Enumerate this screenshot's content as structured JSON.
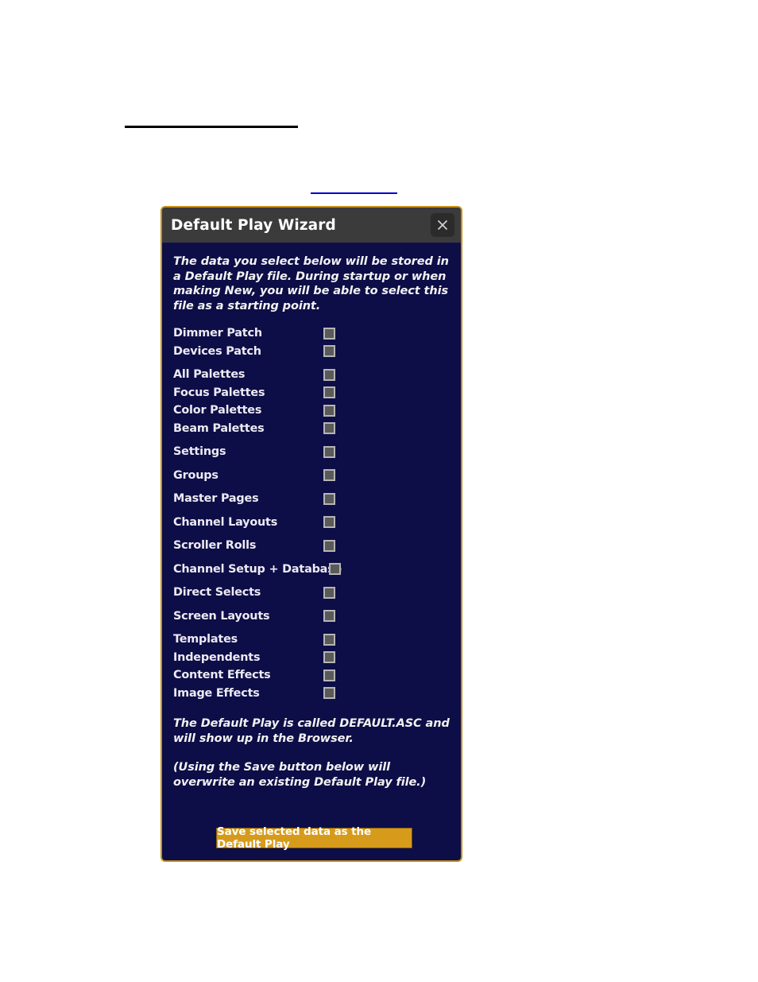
{
  "page": {
    "horizontal_rule": "",
    "link_text": ""
  },
  "dialog": {
    "title": "Default Play Wizard",
    "close_icon": "close-icon",
    "intro_text": "The data you select below will be stored in a Default Play file. During startup or when making New, you will be able to select this file as a starting point.",
    "options": [
      {
        "label": "Dimmer Patch",
        "checked": false
      },
      {
        "label": "Devices Patch",
        "checked": false
      },
      {
        "label": "All Palettes",
        "checked": false
      },
      {
        "label": "Focus Palettes",
        "checked": false
      },
      {
        "label": "Color Palettes",
        "checked": false
      },
      {
        "label": "Beam Palettes",
        "checked": false
      },
      {
        "label": "Settings",
        "checked": false
      },
      {
        "label": "Groups",
        "checked": false
      },
      {
        "label": "Master Pages",
        "checked": false
      },
      {
        "label": "Channel Layouts",
        "checked": false
      },
      {
        "label": "Scroller Rolls",
        "checked": false
      },
      {
        "label": "Channel Setup + Database",
        "checked": false
      },
      {
        "label": "Direct Selects",
        "checked": false
      },
      {
        "label": "Screen Layouts",
        "checked": false
      },
      {
        "label": "Templates",
        "checked": false
      },
      {
        "label": "Independents",
        "checked": false
      },
      {
        "label": "Content Effects",
        "checked": false
      },
      {
        "label": "Image Effects",
        "checked": false
      }
    ],
    "footer_text_1": "The Default Play is called DEFAULT.ASC and will show up in the Browser.",
    "footer_text_2": "(Using the Save button below will overwrite an existing Default Play file.)",
    "save_button_label": "Save selected data as the Default Play",
    "colors": {
      "body_background": "#0d0d47",
      "titlebar_background": "#3b3b3b",
      "border": "#c8911a",
      "button_background": "#d79b1b",
      "label_text": "#eceaf3",
      "link": "#0000cc"
    }
  }
}
